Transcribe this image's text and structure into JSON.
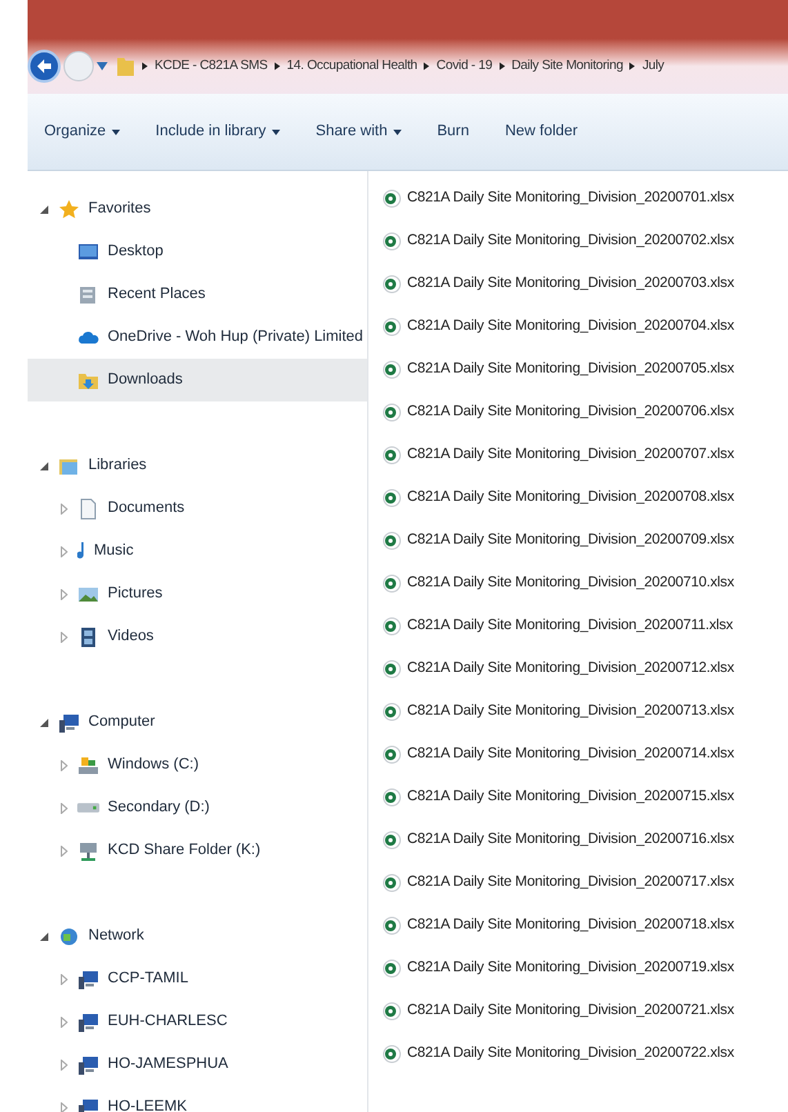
{
  "address_bar": {
    "breadcrumbs": [
      "KCDE - C821A SMS",
      "14. Occupational Health",
      "Covid - 19",
      "Daily Site Monitoring",
      "July"
    ]
  },
  "toolbar": {
    "buttons": [
      {
        "label": "Organize",
        "dropdown": true
      },
      {
        "label": "Include in library",
        "dropdown": true
      },
      {
        "label": "Share with",
        "dropdown": true
      },
      {
        "label": "Burn",
        "dropdown": false
      },
      {
        "label": "New folder",
        "dropdown": false
      }
    ]
  },
  "sidebar": {
    "sections": [
      {
        "label": "Favorites",
        "kind": "star",
        "expanded": true,
        "selected": false,
        "children": [
          {
            "label": "Desktop",
            "kind": "desktop",
            "selected": false
          },
          {
            "label": "Recent Places",
            "kind": "recent",
            "selected": false
          },
          {
            "label": "OneDrive - Woh Hup (Private) Limited",
            "kind": "cloud",
            "selected": false
          },
          {
            "label": "Downloads",
            "kind": "downloads",
            "selected": true
          }
        ]
      },
      {
        "label": "Libraries",
        "kind": "library",
        "expanded": true,
        "selected": false,
        "children": [
          {
            "label": "Documents",
            "kind": "document",
            "expanded": false,
            "selected": false
          },
          {
            "label": "Music",
            "kind": "music",
            "expanded": false,
            "selected": false
          },
          {
            "label": "Pictures",
            "kind": "pictures",
            "expanded": false,
            "selected": false
          },
          {
            "label": "Videos",
            "kind": "videos",
            "expanded": false,
            "selected": false
          }
        ]
      },
      {
        "label": "Computer",
        "kind": "computer",
        "expanded": true,
        "selected": false,
        "children": [
          {
            "label": "Windows (C:)",
            "kind": "system-drive",
            "expanded": false,
            "selected": false
          },
          {
            "label": "Secondary (D:)",
            "kind": "drive",
            "expanded": false,
            "selected": false
          },
          {
            "label": "KCD Share Folder (K:)",
            "kind": "network-drive",
            "expanded": false,
            "selected": false
          }
        ]
      },
      {
        "label": "Network",
        "kind": "network",
        "expanded": true,
        "selected": false,
        "children": [
          {
            "label": "CCP-TAMIL",
            "kind": "computer",
            "expanded": false,
            "selected": false
          },
          {
            "label": "EUH-CHARLESC",
            "kind": "computer",
            "expanded": false,
            "selected": false
          },
          {
            "label": "HO-JAMESPHUA",
            "kind": "computer",
            "expanded": false,
            "selected": false
          },
          {
            "label": "HO-LEEMK",
            "kind": "computer",
            "expanded": false,
            "selected": false
          }
        ]
      }
    ]
  },
  "files": [
    {
      "name": "C821A Daily Site Monitoring_Division_20200701.xlsx"
    },
    {
      "name": "C821A Daily Site Monitoring_Division_20200702.xlsx"
    },
    {
      "name": "C821A Daily Site Monitoring_Division_20200703.xlsx"
    },
    {
      "name": "C821A Daily Site Monitoring_Division_20200704.xlsx"
    },
    {
      "name": "C821A Daily Site Monitoring_Division_20200705.xlsx"
    },
    {
      "name": "C821A Daily Site Monitoring_Division_20200706.xlsx"
    },
    {
      "name": "C821A Daily Site Monitoring_Division_20200707.xlsx"
    },
    {
      "name": "C821A Daily Site Monitoring_Division_20200708.xlsx"
    },
    {
      "name": "C821A Daily Site Monitoring_Division_20200709.xlsx"
    },
    {
      "name": "C821A Daily Site Monitoring_Division_20200710.xlsx"
    },
    {
      "name": "C821A Daily Site Monitoring_Division_20200711.xlsx"
    },
    {
      "name": "C821A Daily Site Monitoring_Division_20200712.xlsx"
    },
    {
      "name": "C821A Daily Site Monitoring_Division_20200713.xlsx"
    },
    {
      "name": "C821A Daily Site Monitoring_Division_20200714.xlsx"
    },
    {
      "name": "C821A Daily Site Monitoring_Division_20200715.xlsx"
    },
    {
      "name": "C821A Daily Site Monitoring_Division_20200716.xlsx"
    },
    {
      "name": "C821A Daily Site Monitoring_Division_20200717.xlsx"
    },
    {
      "name": "C821A Daily Site Monitoring_Division_20200718.xlsx"
    },
    {
      "name": "C821A Daily Site Monitoring_Division_20200719.xlsx"
    },
    {
      "name": "C821A Daily Site Monitoring_Division_20200721.xlsx"
    },
    {
      "name": "C821A Daily Site Monitoring_Division_20200722.xlsx"
    }
  ]
}
